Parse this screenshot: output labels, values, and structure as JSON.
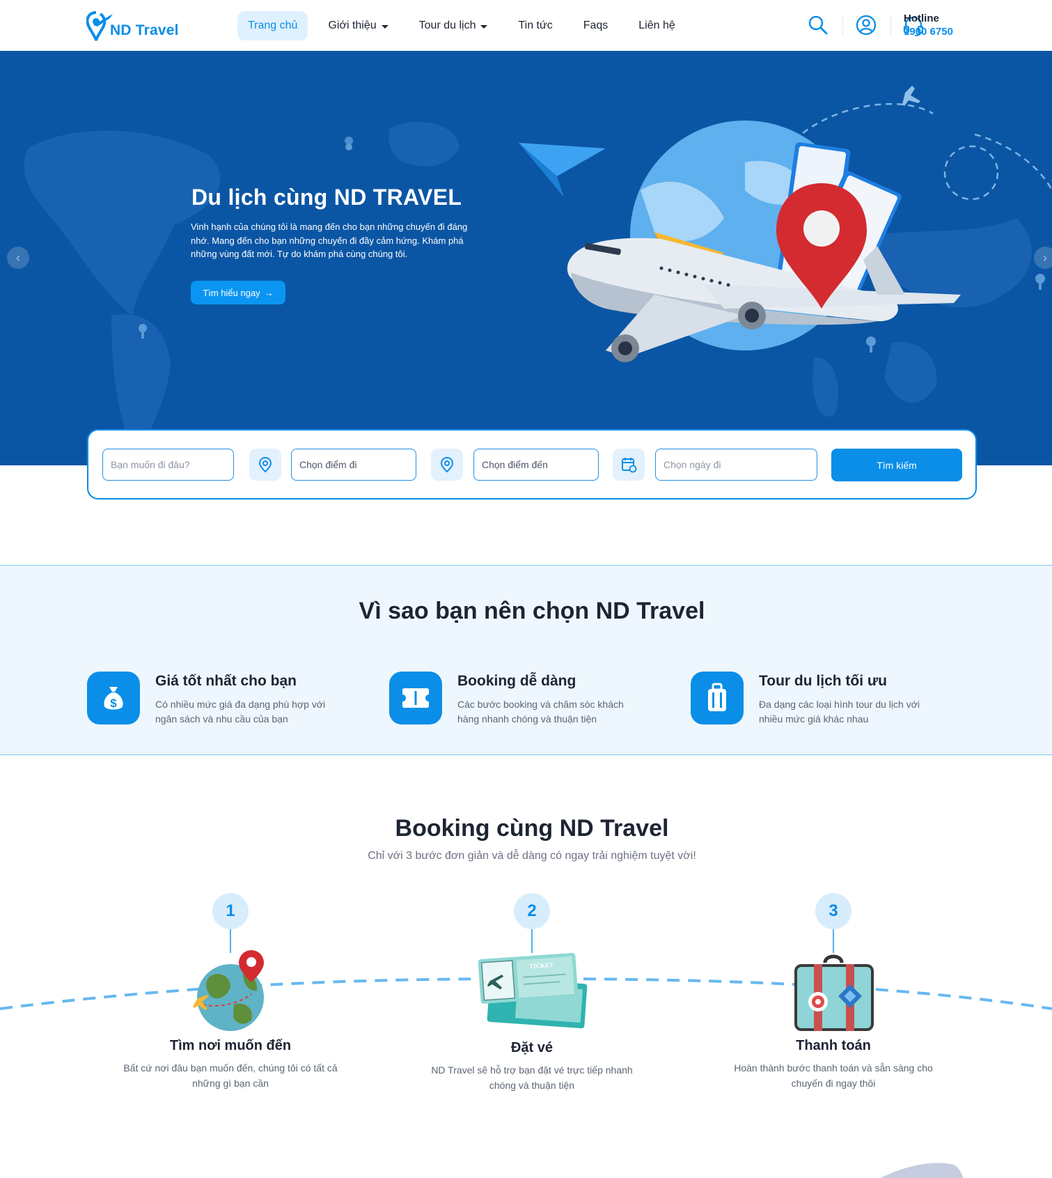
{
  "brand": {
    "name": "ND Travel",
    "color": "#0a8ee8"
  },
  "nav": {
    "items": [
      {
        "label": "Trang chủ",
        "active": true,
        "dropdown": false
      },
      {
        "label": "Giới thiệu",
        "active": false,
        "dropdown": true
      },
      {
        "label": "Tour du lịch",
        "active": false,
        "dropdown": true
      },
      {
        "label": "Tin tức",
        "active": false,
        "dropdown": false
      },
      {
        "label": "Faqs",
        "active": false,
        "dropdown": false
      },
      {
        "label": "Liên hệ",
        "active": false,
        "dropdown": false
      }
    ],
    "icons": [
      "search-icon",
      "user-icon",
      "headset-icon"
    ]
  },
  "hotline": {
    "label": "Hotline",
    "number": "1900 6750"
  },
  "hero": {
    "title": "Du lịch cùng ND TRAVEL",
    "description": "Vinh hạnh của chúng tôi là mang đến cho bạn những chuyến đi đáng nhớ. Mang đến cho bạn những chuyến đi đầy cảm hứng. Khám phá những vùng đất mới. Tự do khám phá cùng chúng tôi.",
    "cta": "Tìm hiểu ngay",
    "background": "#0b56a4"
  },
  "search": {
    "keyword_placeholder": "Bạn muốn đi đâu?",
    "from_placeholder": "Chọn điểm đi",
    "to_placeholder": "Chọn điểm đến",
    "date_placeholder": "Chọn ngày đi",
    "button": "Tìm kiếm"
  },
  "why": {
    "title": "Vì sao bạn nên chọn ND Travel",
    "features": [
      {
        "icon": "money-bag-icon",
        "title": "Giá tốt nhất cho bạn",
        "desc": "Có nhiều mức giá đa dạng phù hợp với ngân sách và nhu cầu của bạn"
      },
      {
        "icon": "ticket-icon",
        "title": "Booking dễ dàng",
        "desc": "Các bước booking và chăm sóc khách hàng nhanh chóng và thuận tiện"
      },
      {
        "icon": "luggage-icon",
        "title": "Tour du lịch tối ưu",
        "desc": "Đa dạng các loại hình tour du lịch với nhiều mức giá khác nhau"
      }
    ]
  },
  "booking": {
    "title": "Booking cùng ND Travel",
    "subtitle": "Chỉ với 3 bước đơn giản và dễ dàng có ngay trải nghiệm tuyệt vời!",
    "steps": [
      {
        "num": "1",
        "title": "Tìm nơi muốn đến",
        "desc": "Bất cứ nơi đâu bạn muốn đến, chúng tôi có tất cả những gì bạn cần",
        "art": "globe-pin-illustration"
      },
      {
        "num": "2",
        "title": "Đặt vé",
        "desc": "ND Travel sẽ hỗ trợ bạn đặt vé trực tiếp nhanh chóng và thuận tiện",
        "art": "tickets-illustration"
      },
      {
        "num": "3",
        "title": "Thanh toán",
        "desc": "Hoàn thành bước thanh toán và sẵn sàng cho chuyến đi ngay thôi",
        "art": "suitcase-illustration"
      }
    ]
  }
}
